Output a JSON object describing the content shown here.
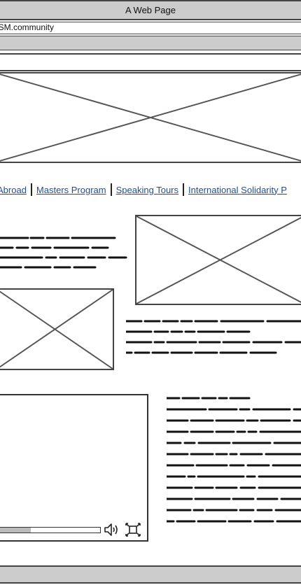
{
  "window": {
    "title": "A Web Page"
  },
  "address_bar": {
    "url": "USM.community"
  },
  "nav": {
    "links": [
      "Abroad",
      "Masters Program",
      "Speaking Tours",
      "International Solidarity P"
    ]
  },
  "icons": {
    "speaker": "speaker-icon",
    "fullscreen": "fullscreen-icon"
  },
  "video": {
    "progress": 0.32
  },
  "colors": {
    "link": "#1f4e9a",
    "chrome_gray": "#cccccc",
    "stroke": "#444444"
  }
}
